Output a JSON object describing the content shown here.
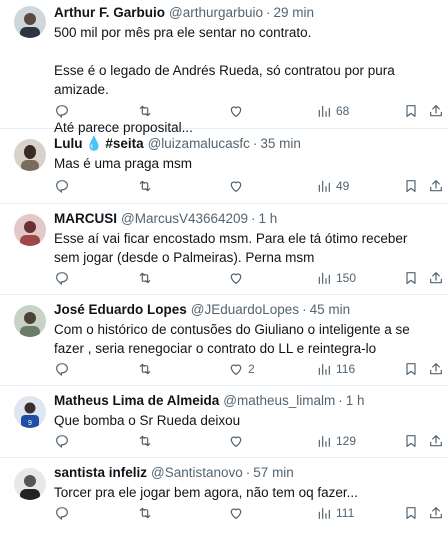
{
  "tweets": [
    {
      "name": "Arthur F. Garbuio",
      "handle": "@arthurgarbuio",
      "sep": "·",
      "time": "29 min",
      "lines": [
        "500 mil por mês pra ele sentar no contrato.",
        "Esse é o legado de Andrés Rueda, só contratou por pura amizade.",
        "Até parece proposital..."
      ],
      "replies": "",
      "likes": "",
      "views": "68"
    },
    {
      "name": "Lulu",
      "name_emoji": "💧",
      "name_tag": "#seita",
      "handle": "@luizamalucasfc",
      "sep": "·",
      "time": "35 min",
      "lines": [
        "Mas é uma praga msm"
      ],
      "replies": "",
      "likes": "",
      "views": "49"
    },
    {
      "name": "MARCUSI",
      "handle": "@MarcusV43664209",
      "sep": "·",
      "time": "1 h",
      "lines": [
        "Esse aí vai ficar encostado msm. Para ele tá ótimo receber sem jogar (desde o Palmeiras). Perna msm"
      ],
      "replies": "",
      "likes": "",
      "views": "150"
    },
    {
      "name": "José Eduardo Lopes",
      "handle": "@JEduardoLopes",
      "sep": "·",
      "time": "45 min",
      "lines": [
        "Com o histórico de contusões do Giuliano o inteligente a se fazer , seria renegociar o contrato do LL e reintegra-lo"
      ],
      "replies": "",
      "likes": "2",
      "views": "116"
    },
    {
      "name": "Matheus Lima de Almeida",
      "handle": "@matheus_limalm",
      "sep": "·",
      "time": "1 h",
      "lines": [
        "Que bomba o Sr Rueda deixou"
      ],
      "replies": "",
      "likes": "",
      "views": "129"
    },
    {
      "name": "santista infeliz",
      "handle": "@Santistanovo",
      "sep": "·",
      "time": "57 min",
      "lines": [
        "Torcer pra ele jogar bem agora, não tem oq fazer..."
      ],
      "replies": "",
      "likes": "",
      "views": "111"
    }
  ]
}
